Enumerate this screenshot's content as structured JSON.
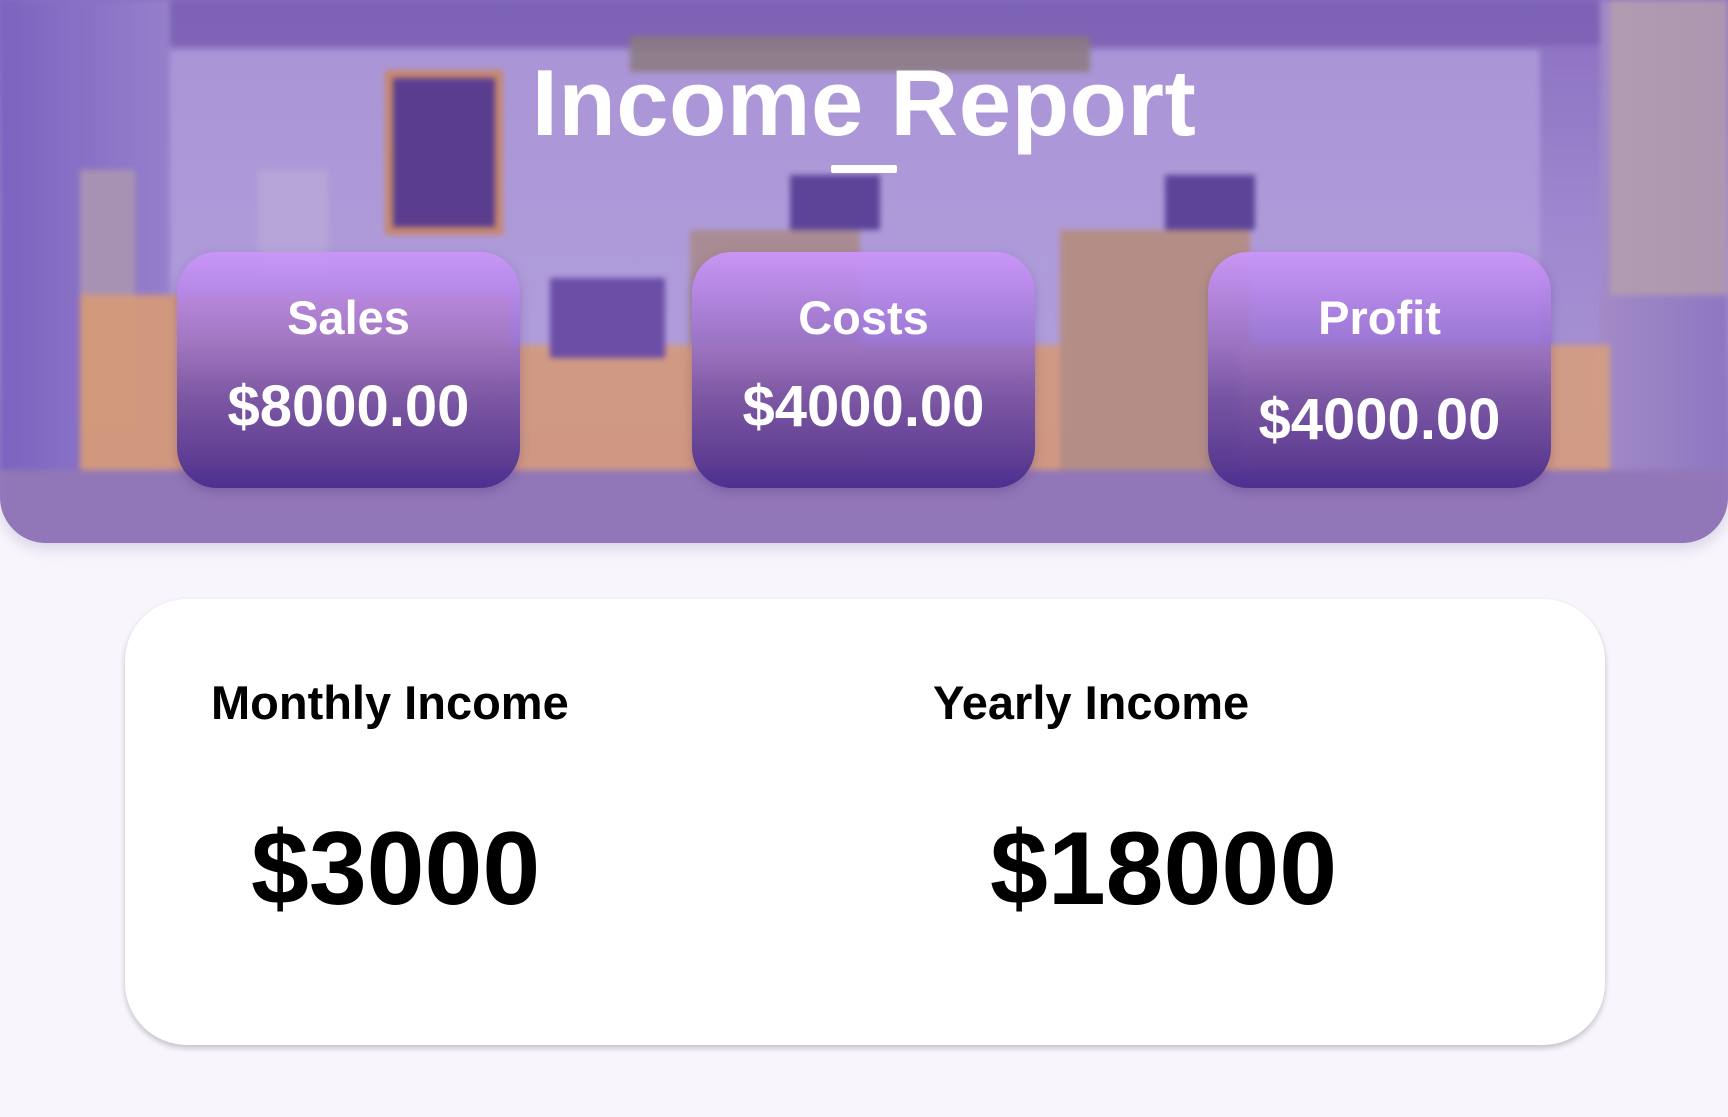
{
  "header": {
    "title": "Income Report"
  },
  "stats": [
    {
      "label": "Sales",
      "value": "$8000.00"
    },
    {
      "label": "Costs",
      "value": "$4000.00"
    },
    {
      "label": "Profit",
      "value": "$4000.00"
    }
  ],
  "income": {
    "monthly": {
      "label": "Monthly Income",
      "value": "$3000"
    },
    "yearly": {
      "label": "Yearly Income",
      "value": "$18000"
    }
  },
  "colors": {
    "hero_background": "#9f87cf",
    "card_top": "#ca96f8",
    "card_bottom": "#4a2c8c",
    "page_background": "#f8f5fc",
    "panel_background": "#ffffff",
    "text_light": "#ffffff",
    "text_dark": "#000000"
  }
}
